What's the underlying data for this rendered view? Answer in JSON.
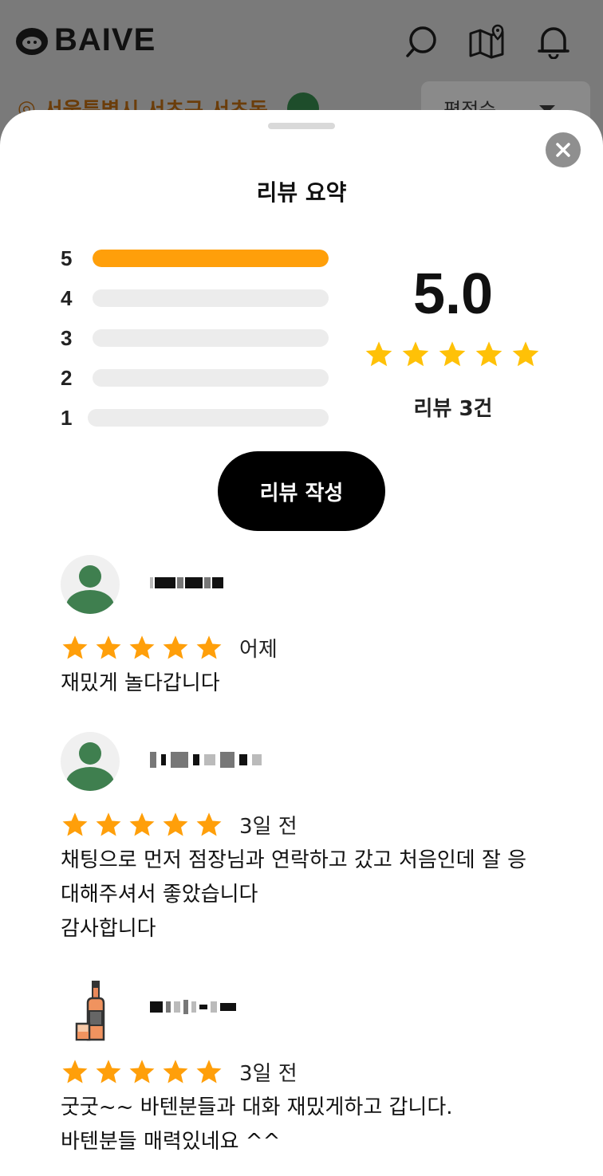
{
  "app": {
    "brand": "BAIVE",
    "location": "서울특별시 서초구 서초동",
    "sort_selected": "평점순",
    "icons": [
      "search-icon",
      "map-icon",
      "bell-icon"
    ]
  },
  "sheet": {
    "title": "리뷰 요약",
    "distribution": [
      {
        "label": "5",
        "fraction": 1.0
      },
      {
        "label": "4",
        "fraction": 0.0
      },
      {
        "label": "3",
        "fraction": 0.0
      },
      {
        "label": "2",
        "fraction": 0.0
      },
      {
        "label": "1",
        "fraction": 0.0
      }
    ],
    "average": "5.0",
    "average_stars": 5,
    "review_count": "리뷰 3건",
    "write_button": "리뷰 작성",
    "colors": {
      "accent": "#ff9f0a",
      "star": "#ffc107",
      "star_review": "#ff9f0a"
    }
  },
  "reviews": [
    {
      "avatar": "default-user-avatar",
      "stars": 5,
      "date": "어제",
      "text": "재밌게 놀다갑니다"
    },
    {
      "avatar": "default-user-avatar",
      "stars": 5,
      "date": "3일 전",
      "text": "채팅으로 먼저 점장님과 연락하고 갔고 처음인데 잘 응\n대해주셔서 좋았습니다\n감사합니다"
    },
    {
      "avatar": "bottle-avatar",
      "stars": 5,
      "date": "3일 전",
      "text": "굿굿~~ 바텐분들과 대화 재밌게하고 갑니다.\n바텐분들 매력있네요 ^^"
    }
  ]
}
